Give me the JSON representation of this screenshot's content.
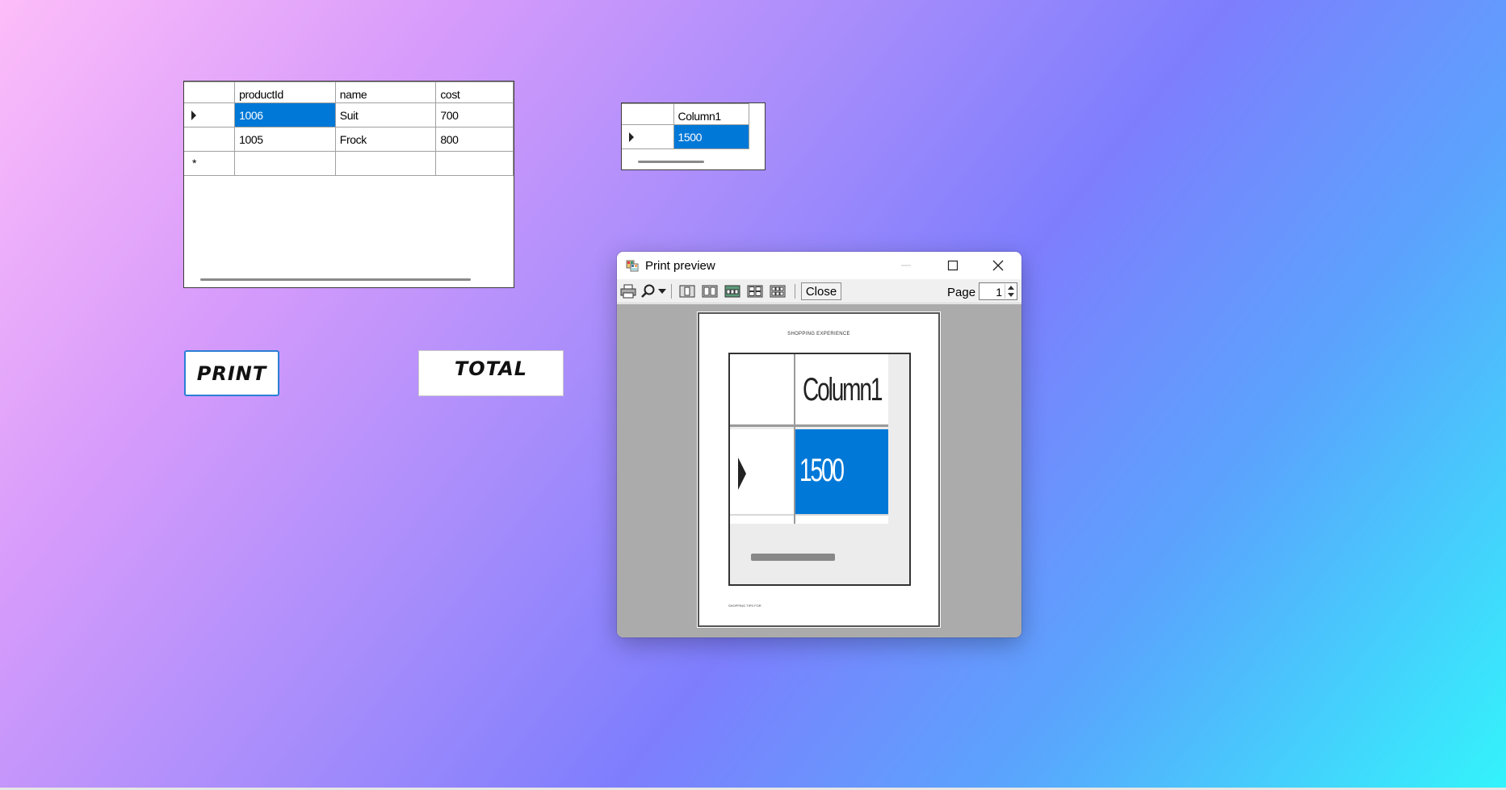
{
  "products_grid": {
    "columns": [
      "productId",
      "name",
      "cost"
    ],
    "rows": [
      {
        "productId": "1006",
        "name": "Suit",
        "cost": "700"
      },
      {
        "productId": "1005",
        "name": "Frock",
        "cost": "800"
      }
    ],
    "selected_cell": "1006"
  },
  "total_grid": {
    "column": "Column1",
    "value": "1500"
  },
  "buttons": {
    "print_label": "PRINT",
    "total_label": "TOTAL"
  },
  "print_preview": {
    "title": "Print preview",
    "close_label": "Close",
    "page_label": "Page",
    "page_value": "1",
    "document_title": "SHOPPING EXPERIENCE",
    "document_footer": "SHOPPING TIPS FOR",
    "preview_column": "Column1",
    "preview_value": "1500"
  },
  "icons": {
    "print": "printer-icon",
    "zoom": "magnifier-icon",
    "one_page": "one-page-icon",
    "two_pages": "two-pages-icon",
    "three_pages": "three-pages-icon",
    "four_pages": "four-pages-icon",
    "six_pages": "six-pages-icon"
  },
  "colors": {
    "selection": "#0078d7",
    "print_button_border": "#2b7fd6"
  }
}
